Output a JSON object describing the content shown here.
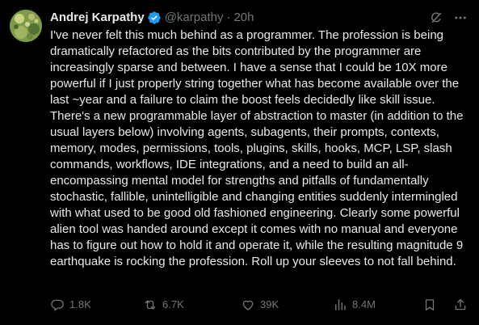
{
  "author": {
    "name": "Andrej Karpathy",
    "handle": "@karpathy",
    "separator": "·",
    "time": "20h"
  },
  "tweet": {
    "text": "I've never felt this much behind as a programmer. The profession is being dramatically refactored as the bits contributed by the programmer are increasingly sparse and between. I have a sense that I could be 10X more powerful if I just properly string together what has become available over the last ~year and a failure to claim the boost feels decidedly like skill issue. There's a new programmable layer of abstraction to master (in addition to the usual layers below) involving agents, subagents, their prompts, contexts, memory, modes, permissions, tools, plugins, skills, hooks, MCP, LSP, slash commands, workflows, IDE integrations, and a need to build an all-encompassing mental model for strengths and pitfalls of fundamentally stochastic, fallible, unintelligible and changing entities suddenly intermingled with what used to be good old fashioned engineering. Clearly some powerful alien tool was handed around except it comes with no manual and everyone has to figure out how to hold it and operate it, while the resulting magnitude 9 earthquake is rocking the profession. Roll up your sleeves to not fall behind."
  },
  "actions": {
    "replies": "1.8K",
    "reposts": "6.7K",
    "likes": "39K",
    "views": "8.4M"
  },
  "icons": {
    "header": [
      "verified-badge-icon",
      "grok-icon",
      "more-icon"
    ],
    "actions": [
      "reply-icon",
      "repost-icon",
      "like-icon",
      "views-icon",
      "bookmark-icon",
      "share-icon"
    ]
  },
  "colors": {
    "background": "#000000",
    "text_primary": "#e7e9ea",
    "text_secondary": "#71767b",
    "verified": "#1d9bf0"
  }
}
